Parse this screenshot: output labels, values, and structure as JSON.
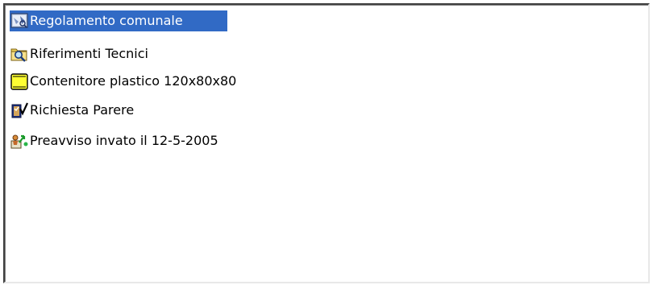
{
  "list": {
    "items": [
      {
        "label": "Regolamento comunale",
        "icon": "regulation-document-icon",
        "selected": true
      },
      {
        "label": "Riferimenti Tecnici",
        "icon": "folder-magnifier-icon",
        "selected": false
      },
      {
        "label": "Contenitore plastico 120x80x80",
        "icon": "yellow-container-icon",
        "selected": false
      },
      {
        "label": "Richiesta Parere",
        "icon": "request-checklist-icon",
        "selected": false
      },
      {
        "label": "Preavviso invato il 12-5-2005",
        "icon": "notice-person-arrow-icon",
        "selected": false
      }
    ]
  },
  "colors": {
    "selection": "#316ac5",
    "selection_text": "#ffffff",
    "text": "#000000",
    "background": "#ffffff"
  }
}
